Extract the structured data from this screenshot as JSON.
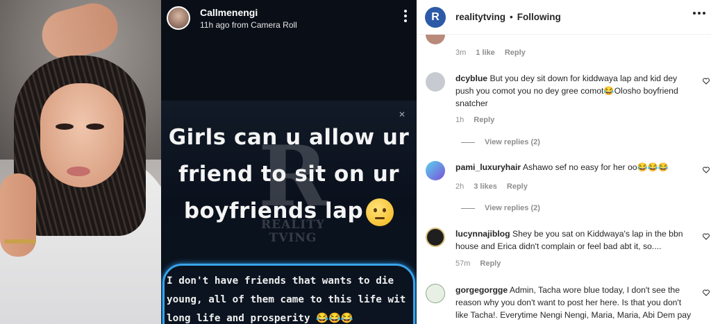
{
  "story": {
    "username": "Callmenengi",
    "subtitle": "11h ago from Camera Roll",
    "caption_lines": [
      "Girls can u allow ur",
      "friend to sit on ur",
      "boyfriends lap"
    ],
    "watermark_letter": "R",
    "watermark_text": [
      "REALITY",
      "TVING"
    ],
    "reply_lines": [
      "I don't have friends that wants to die",
      "young, all of them came to this life wit",
      "long life and prosperity 😂😂😂"
    ]
  },
  "comments_panel": {
    "header": {
      "logo_letter": "R",
      "account": "realitytving",
      "separator": "•",
      "follow_state": "Following"
    },
    "comments": [
      {
        "username": "",
        "text": "",
        "time": "3m",
        "likes": "1 like",
        "reply": "Reply",
        "view_replies": "",
        "avatar_color": "#b98a7a"
      },
      {
        "username": "dcyblue",
        "text": "But you dey sit down for kiddwaya lap and kid dey push you comot you no dey gree comot😂Olosho boyfriend snatcher",
        "time": "1h",
        "likes": "",
        "reply": "Reply",
        "view_replies": "View replies (2)",
        "avatar_color": "#c7cbd1"
      },
      {
        "username": "pami_luxuryhair",
        "text": "Ashawo sef no easy for her oo😂😂😂",
        "time": "2h",
        "likes": "3 likes",
        "reply": "Reply",
        "view_replies": "View replies (2)",
        "avatar_color": "#7a4fd6"
      },
      {
        "username": "lucynnajiblog",
        "text": "Shey be you sat on Kiddwaya's lap in the bbn house and Erica didn't complain or feel bad abt it, so....",
        "time": "57m",
        "likes": "",
        "reply": "Reply",
        "view_replies": "",
        "avatar_color": "#1f1f1f"
      },
      {
        "username": "gorgegorgge",
        "text": "Admin, Tacha wore blue today, I don't see the reason why you don't want to post her here. Is that you don't like Tacha!. Everytime Nengi Nengi, Maria, Maria, Abi Dem pay",
        "time": "",
        "likes": "",
        "reply": "",
        "view_replies": "",
        "avatar_color": "#8fa98a"
      }
    ]
  },
  "colors": {
    "accent_blue": "#39a4ec",
    "story_bg": "#0a0f17",
    "muted_text": "#8e8e8e"
  }
}
